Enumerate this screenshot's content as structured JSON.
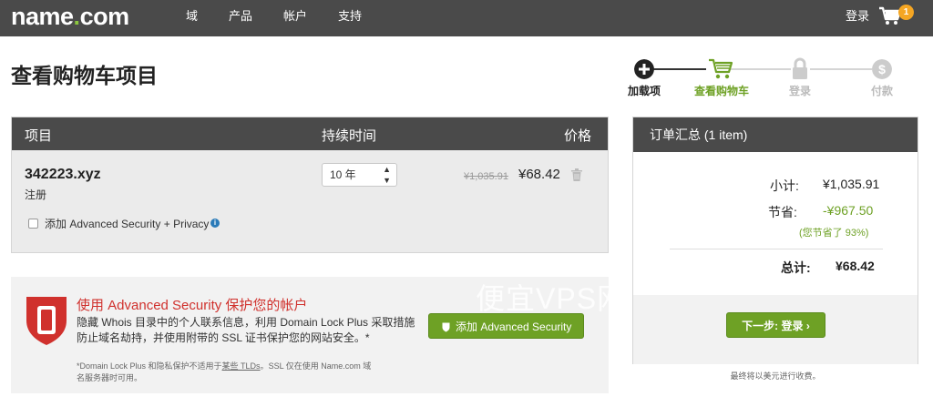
{
  "header": {
    "logo_main": "name",
    "logo_dot": ".",
    "logo_tail": "com",
    "nav": [
      "域",
      "产品",
      "帐户",
      "支持"
    ],
    "login": "登录",
    "cart_count": "1"
  },
  "page_title": "查看购物车项目",
  "steps": [
    {
      "label": "加载项",
      "state": "done"
    },
    {
      "label": "查看购物车",
      "state": "active"
    },
    {
      "label": "登录",
      "state": "pending"
    },
    {
      "label": "付款",
      "state": "pending"
    }
  ],
  "table": {
    "col_item": "项目",
    "col_duration": "持续时间",
    "col_price": "价格",
    "row": {
      "domain": "342223.xyz",
      "type": "注册",
      "duration": "10 年",
      "old_price": "¥1,035.91",
      "price": "¥68.42"
    },
    "addon_label": "添加 Advanced Security + Privacy",
    "info_glyph": "i"
  },
  "promo": {
    "title": "使用 Advanced Security 保护您的帐户",
    "body": "隐藏 Whois 目录中的个人联系信息，利用 Domain Lock Plus 采取措施防止域名劫持，并使用附带的 SSL 证书保护您的网站安全。*",
    "button": "添加 Advanced Security",
    "foot_1": "*Domain Lock Plus 和隐私保护不适用于",
    "foot_link": "某些 TLDs",
    "foot_2": "。SSL 仅在使用 Name.com 域名服务器时可用。"
  },
  "summary": {
    "title": "订单汇总 (1 item)",
    "subtotal_label": "小计:",
    "subtotal": "¥1,035.91",
    "save_label": "节省:",
    "save": "-¥967.50",
    "save_pct": "(您节省了 93%)",
    "total_label": "总计:",
    "total": "¥68.42",
    "next_button": "下一步: 登录",
    "note": "最终将以美元进行收费。"
  },
  "watermark": "便宜VPS网",
  "colors": {
    "header_bg": "#4a4a4a",
    "accent_green": "#6ea125",
    "logo_dot": "#8cc63f",
    "alert_red": "#d0312d",
    "badge_orange": "#f5a623"
  }
}
